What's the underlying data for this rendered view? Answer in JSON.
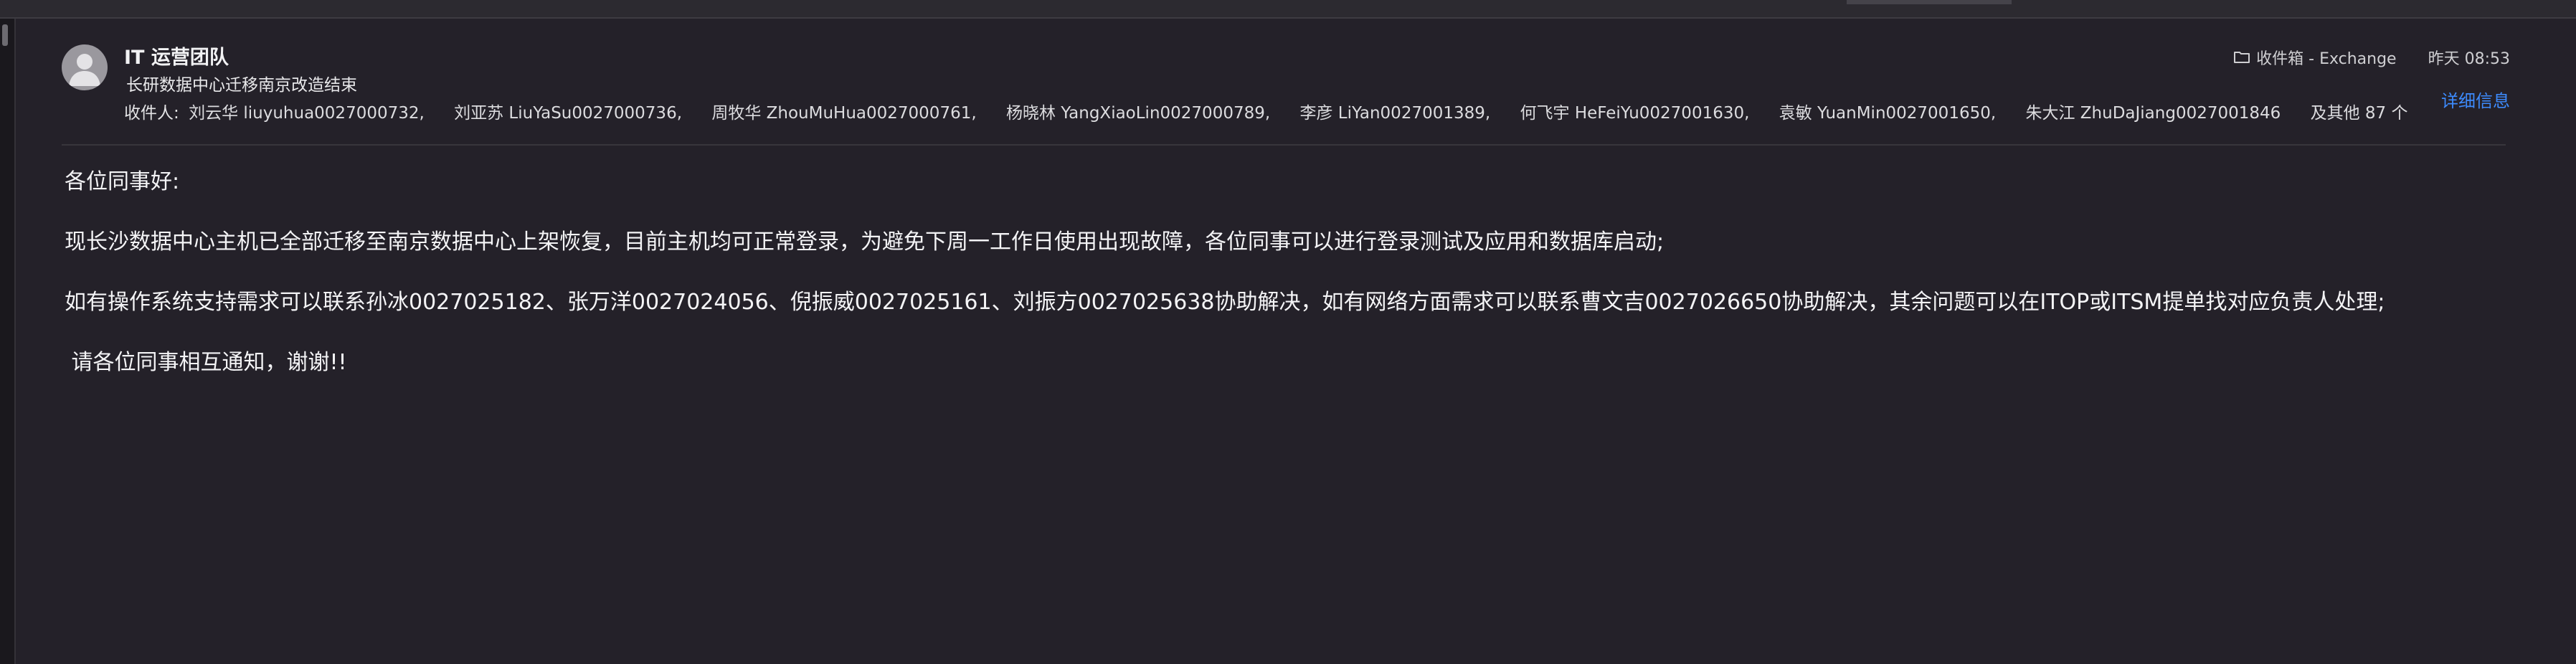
{
  "email": {
    "sender": "IT 运营团队",
    "subject": "长研数据中心迁移南京改造结束",
    "recipients_label": "收件人:",
    "recipients": [
      "刘云华 liuyuhua0027000732,",
      "刘亚苏 LiuYaSu0027000736,",
      "周牧华 ZhouMuHua0027000761,",
      "杨晓林 YangXiaoLin0027000789,",
      "李彦 LiYan0027001389,",
      "何飞宇 HeFeiYu0027001630,",
      "袁敏 YuanMin0027001650,",
      "朱大江 ZhuDaJiang0027001846"
    ],
    "recipients_more": "及其他 87 个",
    "folder_icon": "folder-icon",
    "mailbox": "收件箱 - Exchange",
    "timestamp": "昨天 08:53",
    "details_link": "详细信息",
    "body": {
      "greeting": "各位同事好:",
      "p1": "现长沙数据中心主机已全部迁移至南京数据中心上架恢复，目前主机均可正常登录，为避免下周一工作日使用出现故障，各位同事可以进行登录测试及应用和数据库启动;",
      "p2": "如有操作系统支持需求可以联系孙冰0027025182、张万洋0027024056、倪振威0027025161、刘振方0027025638协助解决，如有网络方面需求可以联系曹文吉0027026650协助解决，其余问题可以在ITOP或ITSM提单找对应负责人处理;",
      "p3": " 请各位同事相互通知，谢谢!!"
    }
  },
  "colors": {
    "background": "#242129",
    "link": "#3d8bfd",
    "text": "#f4f4f6"
  }
}
